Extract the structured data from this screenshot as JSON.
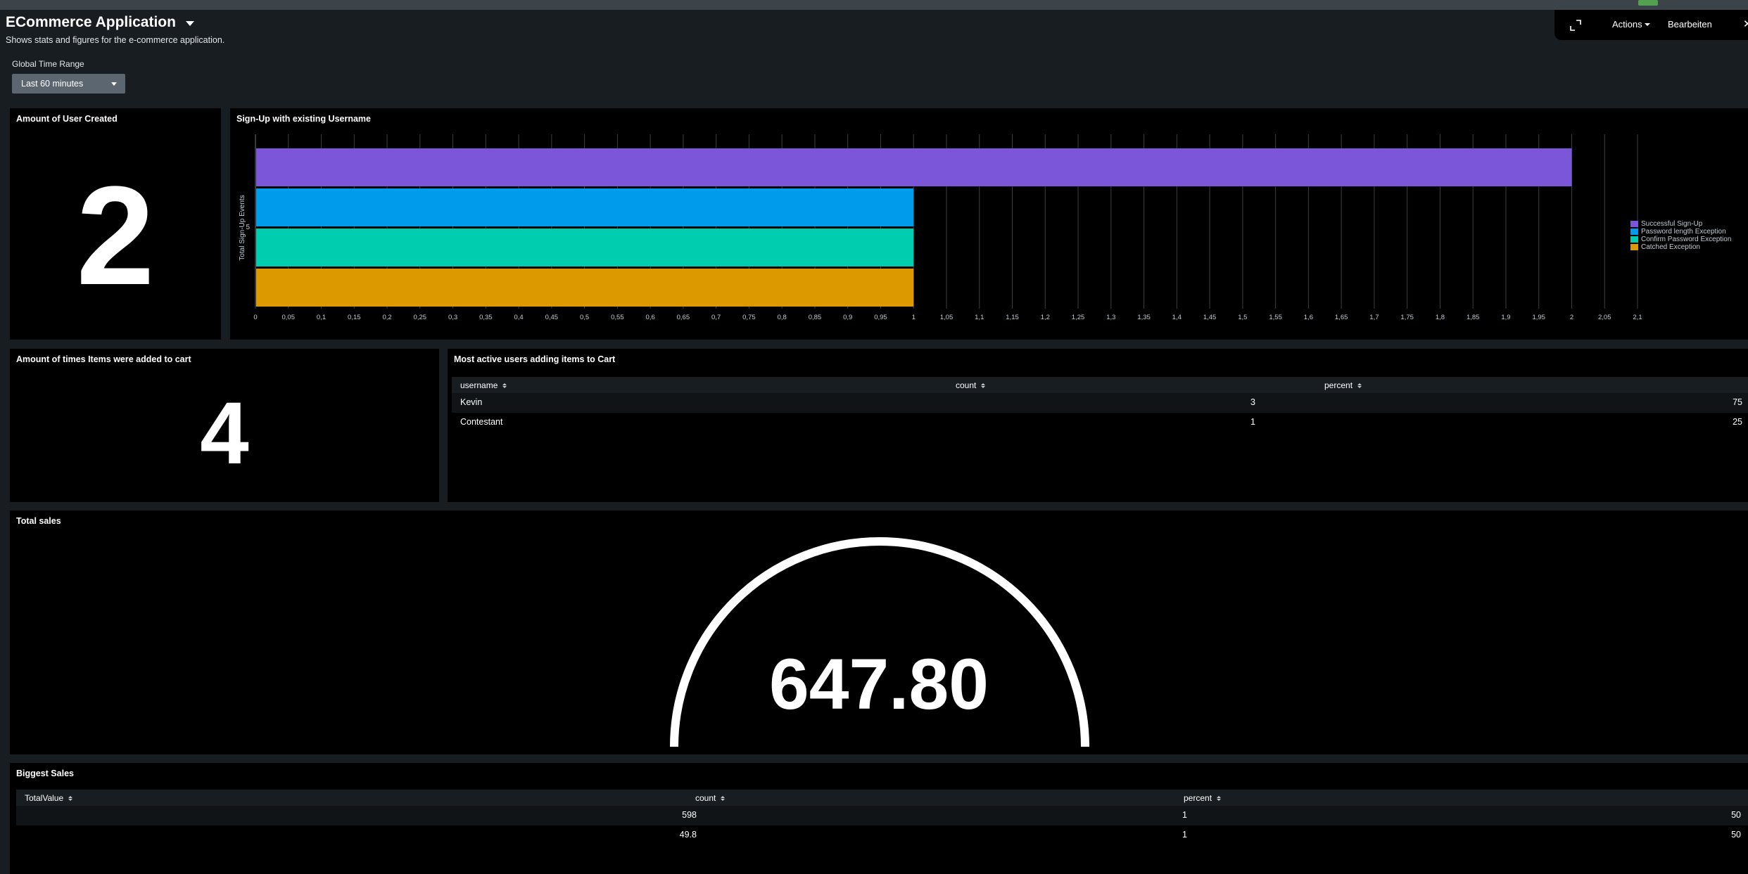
{
  "app": {
    "title": "ECommerce Application",
    "description": "Shows stats and figures for the e-commerce application."
  },
  "toolbar": {
    "expand_icon": "expand-icon",
    "actions_label": "Actions",
    "edit_label": "Bearbeiten",
    "close_icon": "close-icon"
  },
  "time_range": {
    "label": "Global Time Range",
    "value": "Last 60 minutes"
  },
  "panels": {
    "users_created": {
      "title": "Amount of User Created",
      "value": "2"
    },
    "signup": {
      "title": "Sign-Up with existing Username"
    },
    "cart_adds": {
      "title": "Amount of times Items were added to cart",
      "value": "4"
    },
    "active_users": {
      "title": "Most active users adding items to Cart",
      "columns": [
        "username",
        "count",
        "percent"
      ],
      "rows": [
        {
          "username": "Kevin",
          "count": "3",
          "percent": "75"
        },
        {
          "username": "Contestant",
          "count": "1",
          "percent": "25"
        }
      ]
    },
    "total_sales": {
      "title": "Total sales",
      "value": "647.80"
    },
    "biggest_sales": {
      "title": "Biggest Sales",
      "columns": [
        "TotalValue",
        "count",
        "percent"
      ],
      "rows": [
        {
          "total": "598",
          "count": "1",
          "percent": "50"
        },
        {
          "total": "49.8",
          "count": "1",
          "percent": "50"
        }
      ]
    }
  },
  "chart_data": {
    "type": "bar",
    "orientation": "horizontal",
    "title": "Sign-Up with existing Username",
    "xlabel": "",
    "ylabel": "Total Sign-Up Events",
    "y_tick_labels": [
      "5"
    ],
    "xlim": [
      0,
      2.1
    ],
    "x_ticks": [
      "0",
      "0,05",
      "0,1",
      "0,15",
      "0,2",
      "0,25",
      "0,3",
      "0,35",
      "0,4",
      "0,45",
      "0,5",
      "0,55",
      "0,6",
      "0,65",
      "0,7",
      "0,75",
      "0,8",
      "0,85",
      "0,9",
      "0,95",
      "1",
      "1,05",
      "1,1",
      "1,15",
      "1,2",
      "1,25",
      "1,3",
      "1,35",
      "1,4",
      "1,45",
      "1,5",
      "1,55",
      "1,6",
      "1,65",
      "1,7",
      "1,75",
      "1,8",
      "1,85",
      "1,9",
      "1,95",
      "2",
      "2,05",
      "2,1"
    ],
    "grid": true,
    "legend_position": "right",
    "series": [
      {
        "name": "Successful Sign-Up",
        "value": 2,
        "color": "#7c56d8"
      },
      {
        "name": "Password length Exception",
        "value": 1,
        "color": "#009ceb"
      },
      {
        "name": "Confirm Password Exception",
        "value": 1,
        "color": "#00cdaf"
      },
      {
        "name": "Catched Exception",
        "value": 1,
        "color": "#dd9900"
      }
    ]
  },
  "gauge": {
    "value": 647.8
  }
}
